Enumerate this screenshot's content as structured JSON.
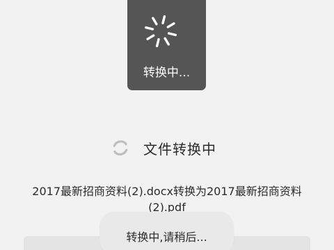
{
  "loading_hud": {
    "label": "转换中...",
    "icon": "spinner-icon",
    "background": "#555555"
  },
  "conversion": {
    "status_icon": "refresh-icon",
    "status_text": "文件转换中",
    "description": "2017最新招商资料(2).docx转换为2017最新招商资料(2).pdf"
  },
  "toast": {
    "message": "转换中,请稍后..."
  }
}
